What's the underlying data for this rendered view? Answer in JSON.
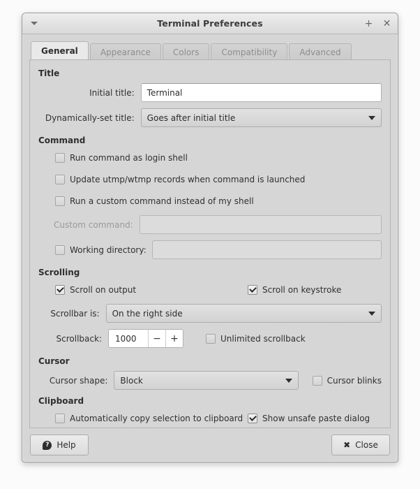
{
  "window": {
    "title": "Terminal Preferences",
    "menu_icon": "triangle-down-icon",
    "maximize_label": "+",
    "close_label": "✕"
  },
  "tabs": [
    {
      "label": "General",
      "active": true
    },
    {
      "label": "Appearance",
      "active": false
    },
    {
      "label": "Colors",
      "active": false
    },
    {
      "label": "Compatibility",
      "active": false
    },
    {
      "label": "Advanced",
      "active": false
    }
  ],
  "sections": {
    "title": {
      "heading": "Title",
      "initial_title_label": "Initial title:",
      "initial_title_value": "Terminal",
      "dynamic_title_label": "Dynamically-set title:",
      "dynamic_title_value": "Goes after initial title"
    },
    "command": {
      "heading": "Command",
      "login_shell_label": "Run command as login shell",
      "login_shell_checked": false,
      "utmp_label": "Update utmp/wtmp records when command is launched",
      "utmp_checked": false,
      "custom_command_check_label": "Run a custom command instead of my shell",
      "custom_command_checked": false,
      "custom_command_label": "Custom command:",
      "custom_command_value": "",
      "working_directory_label": "Working directory:",
      "working_directory_checked": false,
      "working_directory_value": ""
    },
    "scrolling": {
      "heading": "Scrolling",
      "scroll_on_output_label": "Scroll on output",
      "scroll_on_output_checked": true,
      "scroll_on_keystroke_label": "Scroll on keystroke",
      "scroll_on_keystroke_checked": true,
      "scrollbar_label": "Scrollbar is:",
      "scrollbar_value": "On the right side",
      "scrollback_label": "Scrollback:",
      "scrollback_value": "1000",
      "spin_down_label": "−",
      "spin_up_label": "+",
      "unlimited_label": "Unlimited scrollback",
      "unlimited_checked": false
    },
    "cursor": {
      "heading": "Cursor",
      "shape_label": "Cursor shape:",
      "shape_value": "Block",
      "blinks_label": "Cursor blinks",
      "blinks_checked": false
    },
    "clipboard": {
      "heading": "Clipboard",
      "autocopy_label": "Automatically copy selection to clipboard",
      "autocopy_checked": false,
      "unsafe_paste_label": "Show unsafe paste dialog",
      "unsafe_paste_checked": true
    }
  },
  "actions": {
    "help_label": "Help",
    "help_glyph": "?",
    "close_label": "Close",
    "close_glyph": "✖"
  }
}
